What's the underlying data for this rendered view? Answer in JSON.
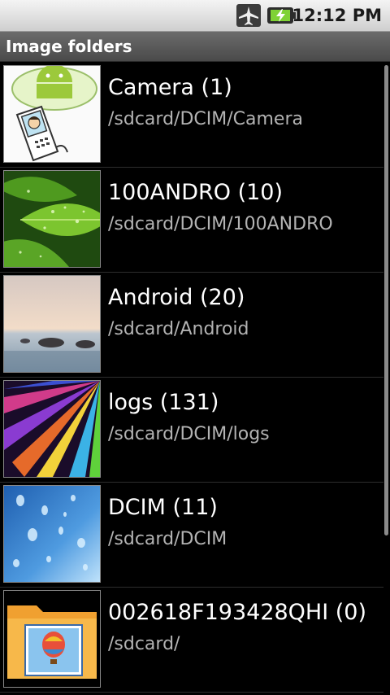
{
  "status_bar": {
    "time": "12:12 PM",
    "icons": [
      "airplane-mode-icon",
      "battery-charging-icon"
    ]
  },
  "title_bar": {
    "title": "Image folders"
  },
  "folders": [
    {
      "name": "Camera (1)",
      "path": "/sdcard/DCIM/Camera",
      "thumb": "android-cartoon-thumbnail"
    },
    {
      "name": "100ANDRO (10)",
      "path": "/sdcard/DCIM/100ANDRO",
      "thumb": "green-leaf-thumbnail"
    },
    {
      "name": "Android (20)",
      "path": "/sdcard/Android",
      "thumb": "sunset-rocks-thumbnail"
    },
    {
      "name": "logs (131)",
      "path": "/sdcard/DCIM/logs",
      "thumb": "colorful-petals-thumbnail"
    },
    {
      "name": "DCIM (11)",
      "path": "/sdcard/DCIM",
      "thumb": "water-drops-thumbnail"
    },
    {
      "name": "002618F193428QHI (0)",
      "path": "/sdcard/",
      "thumb": "folder-balloon-thumbnail"
    }
  ]
}
